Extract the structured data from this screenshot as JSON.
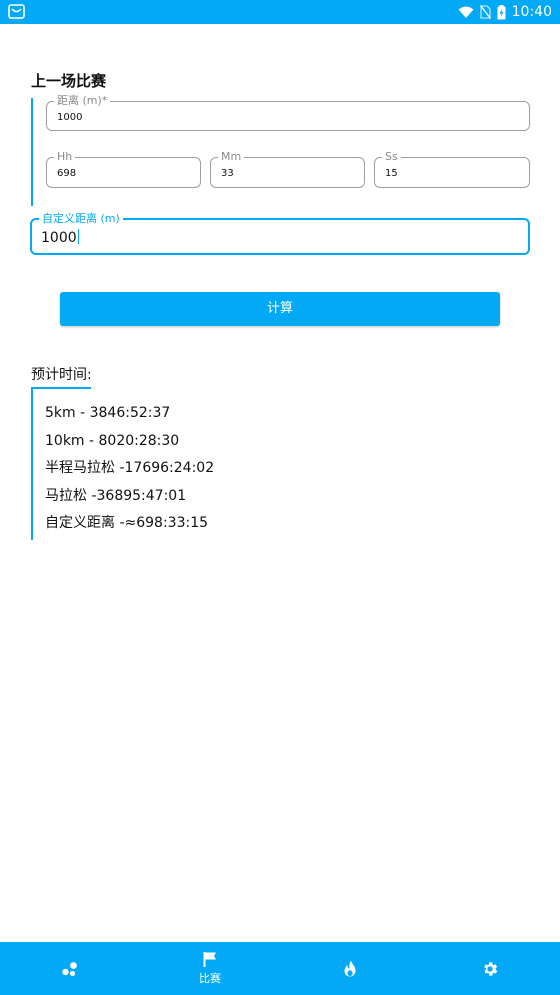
{
  "status_bar": {
    "time": "10:40",
    "icons": [
      "shopping-bag-icon",
      "wifi-icon",
      "no-sim-icon",
      "battery-icon"
    ]
  },
  "form": {
    "section_title": "上一场比赛",
    "distance": {
      "label": "距离 (m)*",
      "value": "1000"
    },
    "hh": {
      "label": "Hh",
      "value": "698"
    },
    "mm": {
      "label": "Mm",
      "value": "33"
    },
    "ss": {
      "label": "Ss",
      "value": "15"
    },
    "custom_distance": {
      "label": "自定义距离 (m)",
      "value": "1000"
    }
  },
  "calculate_button": "计算",
  "results": {
    "title": "预计时间:",
    "rows": [
      "5km - 3846:52:37",
      "10km - 8020:28:30",
      "半程马拉松 -17696:24:02",
      "马拉松 -36895:47:01",
      "自定义距离 -≈698:33:15"
    ]
  },
  "bottom_nav": {
    "items": [
      {
        "icon": "dots-icon",
        "label": ""
      },
      {
        "icon": "flag-icon",
        "label": "比赛"
      },
      {
        "icon": "flame-icon",
        "label": ""
      },
      {
        "icon": "gear-icon",
        "label": ""
      }
    ],
    "active_index": 1
  },
  "colors": {
    "accent": "#03a9f4",
    "border": "#9e9e9e",
    "label": "#8a8a8a"
  }
}
